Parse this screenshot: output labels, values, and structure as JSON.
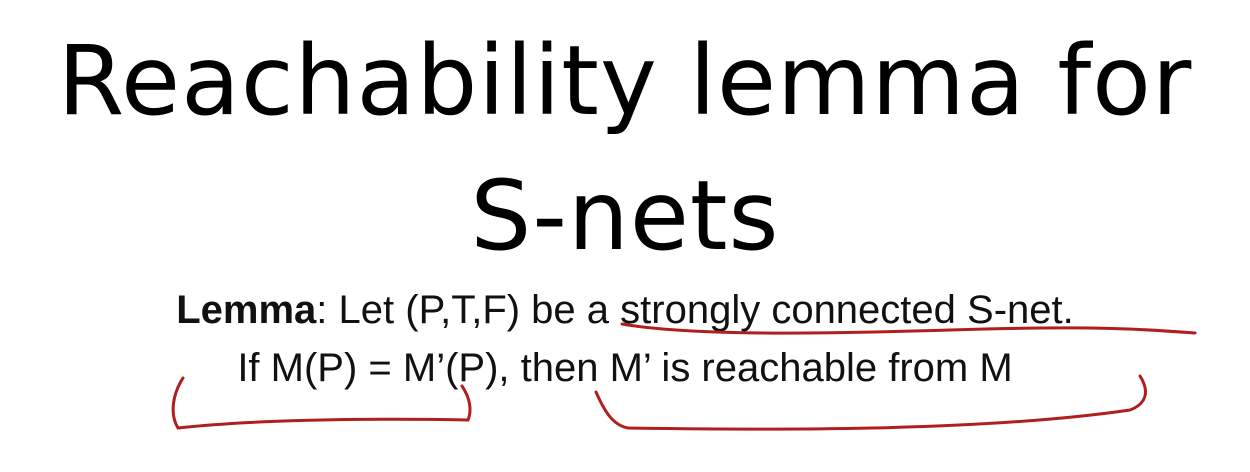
{
  "title": {
    "line1": "Reachability lemma for",
    "line2": "S-nets"
  },
  "lemma": {
    "label": "Lemma",
    "line1_text": ": Let (P,T,F) be a strongly connected S-net.",
    "line2_text": "If M(P) = M’(P), then M’ is reachable from M"
  },
  "annotations": {
    "ink_color": "#b01e1e"
  }
}
